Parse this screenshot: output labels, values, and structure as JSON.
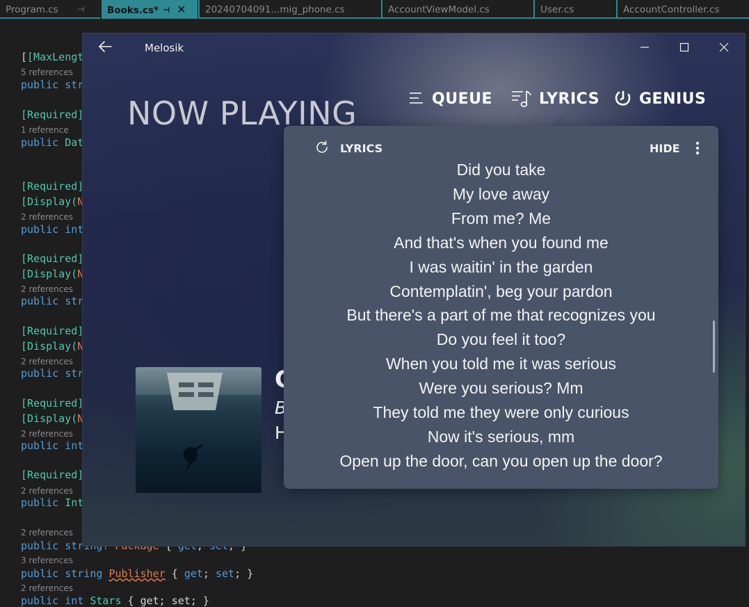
{
  "editor": {
    "tabs": [
      {
        "label": "Program.cs",
        "pin": "⊣"
      },
      {
        "label": "Books.cs*",
        "pin": "⊣",
        "close": "✕"
      },
      {
        "label": "20240704091...mig_phone.cs"
      },
      {
        "label": "AccountViewModel.cs"
      },
      {
        "label": "User.cs"
      },
      {
        "label": "AccountController.cs"
      }
    ],
    "code": {
      "l1": "[MaxLength",
      "r1": "5 references",
      "l2a": "public",
      "l2b": "str",
      "l3": "[Required]",
      "r2": "1 reference",
      "l4a": "public",
      "l4b": "Dat",
      "l5": "[Required]",
      "l6a": "[Display(",
      "l6b": "N",
      "r3": "2 references",
      "l7a": "public",
      "l7b": "int",
      "l8": "[Required]",
      "l9a": "[Display(",
      "l9b": "N",
      "r4": "2 references",
      "l10a": "public",
      "l10b": "str",
      "l11": "[Required]",
      "l12a": "[Display(",
      "l12b": "N",
      "r5": "2 references",
      "l13a": "public",
      "l13b": "str",
      "l14": "[Required]",
      "l15a": "[Display(",
      "l15b": "N",
      "r6": "2 references",
      "l16a": "public",
      "l16b": "int",
      "l17": "[Required]",
      "r7": "2 references",
      "l18a": "public",
      "l18b": "Int",
      "r8": "2 references",
      "l19a": "public string? ",
      "l19b": "Package",
      "l19c": " { ",
      "l19d": "get",
      "l19e": "; ",
      "l19f": "set",
      "l19g": "; }",
      "r9": "3 references",
      "l20a": "public string ",
      "l20b": "Publisher",
      "l20c": " { ",
      "l20d": "get",
      "l20e": "; ",
      "l20f": "set",
      "l20g": "; }",
      "r10": "2 references",
      "l21a": "public int ",
      "l21b": "Stars",
      "l21c": " { get; set; }"
    }
  },
  "player": {
    "app_title": "Melosik",
    "heading": "NOW PLAYING",
    "nav": {
      "queue": "QUEUE",
      "lyrics": "LYRICS",
      "genius": "GENIUS"
    },
    "song_fragments": {
      "title": "C",
      "artist": "B",
      "album": "H"
    },
    "lyrics_panel": {
      "header": "LYRICS",
      "hide": "HIDE",
      "lines": [
        "Did you take",
        "My love away",
        "From me? Me",
        "And that's when you found me",
        "I was waitin' in the garden",
        "Contemplatin', beg your pardon",
        "But there's a part of me that recognizes you",
        "Do you feel it too?",
        "When you told me it was serious",
        "Were you serious? Mm",
        "They told me they were only curious",
        "Now it's serious, mm",
        "Open up the door, can you open up the door?"
      ]
    }
  },
  "colors": {
    "tab_accent": "#2d8a93",
    "keyword": "#569cd6",
    "attribute": "#4ec9b0",
    "property": "#e07b53",
    "flyout_bg": "#4a5468"
  }
}
